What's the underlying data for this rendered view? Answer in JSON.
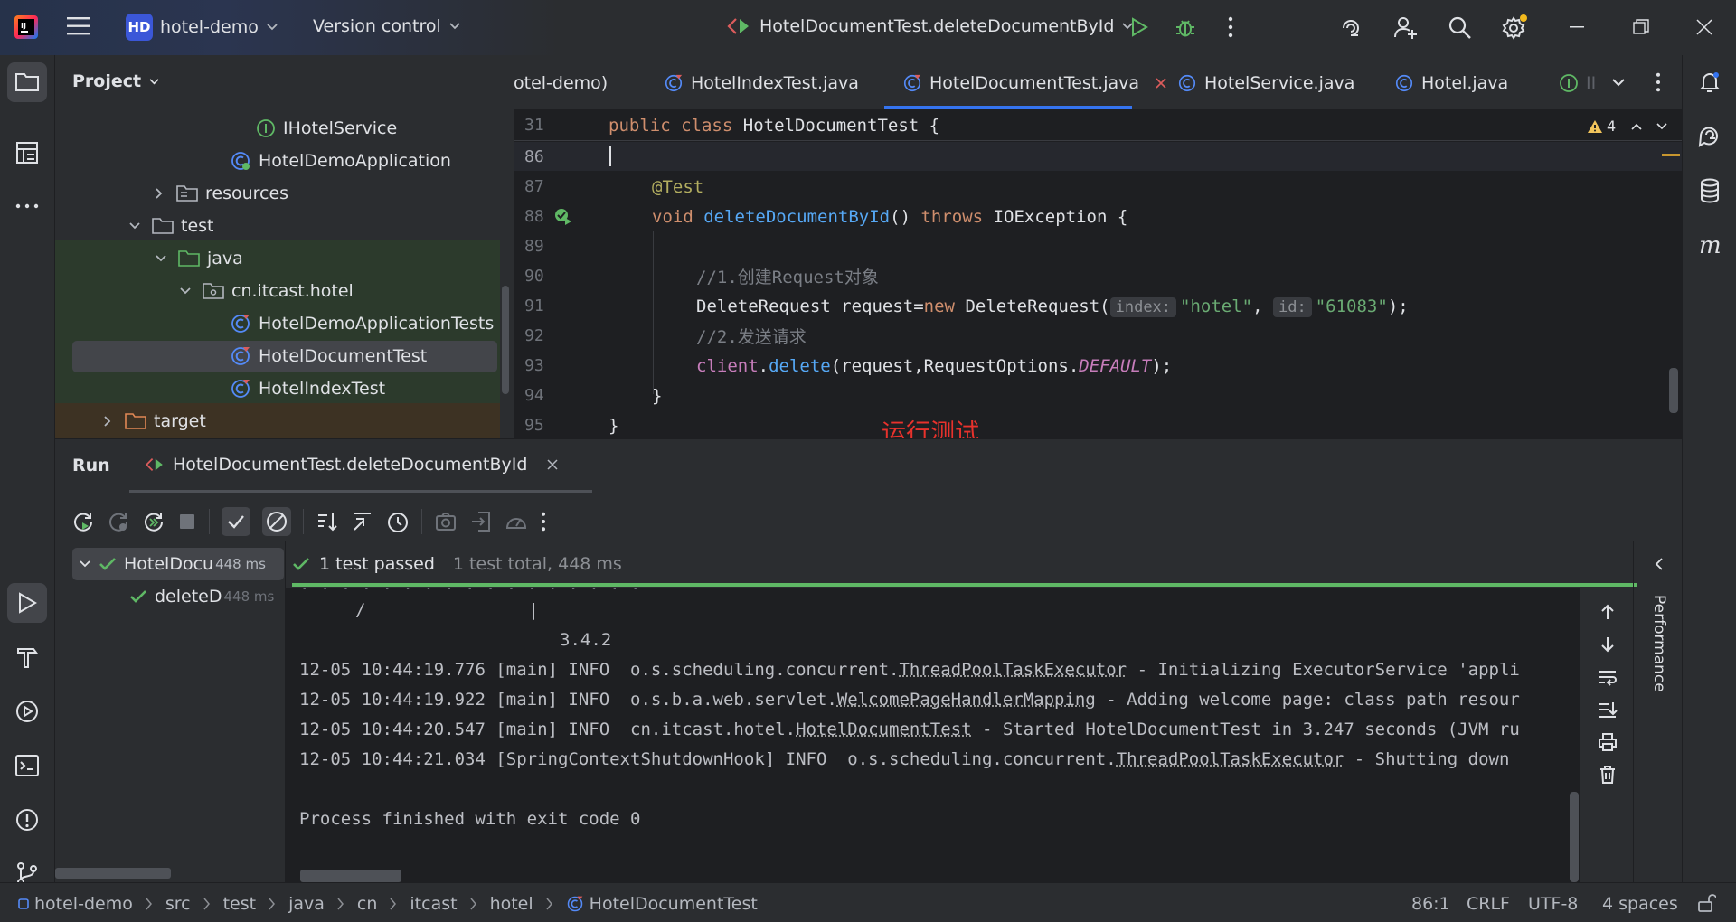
{
  "titlebar": {
    "project_badge": "HD",
    "project_name": "hotel-demo",
    "vcs": "Version control",
    "run_config": "HotelDocumentTest.deleteDocumentById"
  },
  "project_panel": {
    "title": "Project",
    "items": [
      {
        "label": "IHotelService",
        "type": "interface"
      },
      {
        "label": "HotelDemoApplication",
        "type": "app-class"
      },
      {
        "label": "resources",
        "type": "folder"
      },
      {
        "label": "test",
        "type": "folder"
      },
      {
        "label": "java",
        "type": "folder"
      },
      {
        "label": "cn.itcast.hotel",
        "type": "package"
      },
      {
        "label": "HotelDemoApplicationTests",
        "type": "test-class"
      },
      {
        "label": "HotelDocumentTest",
        "type": "test-class"
      },
      {
        "label": "HotelIndexTest",
        "type": "test-class"
      },
      {
        "label": "target",
        "type": "folder"
      }
    ]
  },
  "editor": {
    "tabs": [
      {
        "label": "otel-demo)"
      },
      {
        "label": "HotelIndexTest.java"
      },
      {
        "label": "HotelDocumentTest.java",
        "active": true
      },
      {
        "label": "HotelService.java"
      },
      {
        "label": "Hotel.java"
      },
      {
        "label": "II"
      }
    ],
    "warning_count": "4",
    "sticky_line_no": "31",
    "lines": [
      "86",
      "87",
      "88",
      "89",
      "90",
      "91",
      "92",
      "93",
      "94",
      "95"
    ],
    "code": {
      "l31a": "public",
      "l31b": "class",
      "l31c": "HotelDocumentTest {",
      "l87": "@Test",
      "l88a": "void",
      "l88b": "deleteDocumentById",
      "l88c": "()",
      "l88d": "throws",
      "l88e": "IOException {",
      "l90": "//1.创建Request对象",
      "l91a": "DeleteRequest request=",
      "l91b": "new",
      "l91c": "DeleteRequest(",
      "l91_hint1": "index:",
      "l91_str1": "\"hotel\"",
      "l91_comma": ",",
      "l91_hint2": "id:",
      "l91_str2": "\"61083\"",
      "l91_end": ");",
      "l92": "//2.发送请求",
      "l93a": "client",
      "l93b": ".",
      "l93c": "delete",
      "l93d": "(request,RequestOptions.",
      "l93e": "DEFAULT",
      "l93f": ");",
      "l94": "}",
      "l95": "}"
    },
    "annotation": "运行测试"
  },
  "run": {
    "label": "Run",
    "tab": "HotelDocumentTest.deleteDocumentById",
    "tree_root": "HotelDocu",
    "tree_root_time": "448 ms",
    "tree_child": "deleteD",
    "tree_child_time": "448 ms",
    "status": "1 test passed",
    "status_detail": "1 test total, 448 ms",
    "side_label": "Performance",
    "console": {
      "line1a": "/",
      "line1b": "|",
      "line2": "3.4.2",
      "log1a": "12-05 10:44:19.776 [main] INFO  o.s.scheduling.concurrent.",
      "log1b": "ThreadPoolTaskExecutor",
      "log1c": " - Initializing ExecutorService 'appli",
      "log2a": "12-05 10:44:19.922 [main] INFO  o.s.b.a.web.servlet.",
      "log2b": "WelcomePageHandlerMapping",
      "log2c": " - Adding welcome page: class path resour",
      "log3a": "12-05 10:44:20.547 [main] INFO  cn.itcast.hotel.",
      "log3b": "HotelDocumentTest",
      "log3c": " - Started HotelDocumentTest in 3.247 seconds (JVM ru",
      "log4a": "12-05 10:44:21.034 [SpringContextShutdownHook] INFO  o.s.scheduling.concurrent.",
      "log4b": "ThreadPoolTaskExecutor",
      "log4c": " - Shutting down",
      "finish": "Process finished with exit code 0"
    }
  },
  "statusbar": {
    "crumbs": [
      "hotel-demo",
      "src",
      "test",
      "java",
      "cn",
      "itcast",
      "hotel",
      "HotelDocumentTest"
    ],
    "position": "86:1",
    "line_sep": "CRLF",
    "encoding": "UTF-8",
    "indent": "4 spaces"
  },
  "colors": {
    "accent": "#3574f0",
    "success": "#5fb865",
    "annotation": "#e8322c",
    "bg": "#1e1f22",
    "panel": "#2b2d30"
  }
}
